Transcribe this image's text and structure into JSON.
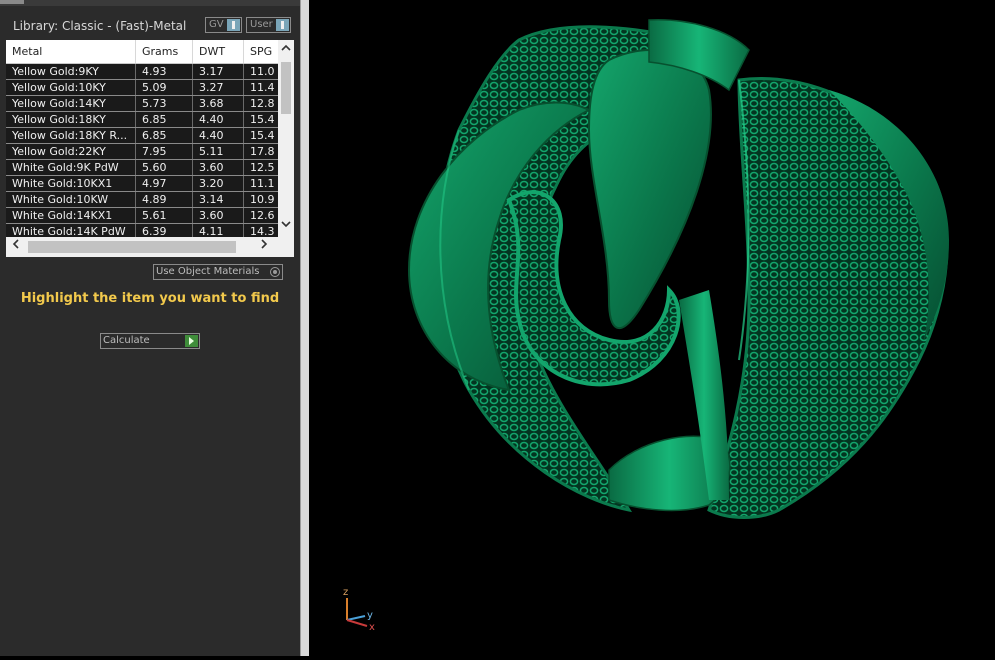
{
  "library": {
    "title": "Library: Classic - (Fast)-Metal",
    "toggles": [
      {
        "label": "GV"
      },
      {
        "label": "User"
      }
    ]
  },
  "table": {
    "columns": [
      "Metal",
      "Grams",
      "DWT",
      "SPG"
    ],
    "rows": [
      {
        "metal": "Yellow Gold:9KY",
        "grams": "4.93",
        "dwt": "3.17",
        "spg": "11.0"
      },
      {
        "metal": "Yellow Gold:10KY",
        "grams": "5.09",
        "dwt": "3.27",
        "spg": "11.4"
      },
      {
        "metal": "Yellow Gold:14KY",
        "grams": "5.73",
        "dwt": "3.68",
        "spg": "12.8"
      },
      {
        "metal": "Yellow Gold:18KY",
        "grams": "6.85",
        "dwt": "4.40",
        "spg": "15.4"
      },
      {
        "metal": "Yellow Gold:18KY R...",
        "grams": "6.85",
        "dwt": "4.40",
        "spg": "15.4"
      },
      {
        "metal": "Yellow Gold:22KY",
        "grams": "7.95",
        "dwt": "5.11",
        "spg": "17.8"
      },
      {
        "metal": "White Gold:9K PdW",
        "grams": "5.60",
        "dwt": "3.60",
        "spg": "12.5"
      },
      {
        "metal": "White Gold:10KX1",
        "grams": "4.97",
        "dwt": "3.20",
        "spg": "11.1"
      },
      {
        "metal": "White Gold:10KW",
        "grams": "4.89",
        "dwt": "3.14",
        "spg": "10.9"
      },
      {
        "metal": "White Gold:14KX1",
        "grams": "5.61",
        "dwt": "3.60",
        "spg": "12.6"
      },
      {
        "metal": "White Gold:14K PdW",
        "grams": "6.39",
        "dwt": "4.11",
        "spg": "14.3"
      }
    ]
  },
  "use_object_materials": {
    "label": "Use Object Materials"
  },
  "highlight_message": "Highlight the item you want to find",
  "calculate": {
    "label": "Calculate"
  },
  "axis": {
    "z": "z",
    "y": "y",
    "x": "x"
  },
  "colors": {
    "ring_green": "#0f8a5a",
    "ring_dark": "#04402a",
    "panel_bg": "#2b2b2b",
    "highlight": "#f2c94c"
  },
  "icons": {
    "scroll_up": "chevron-up-icon",
    "scroll_down": "chevron-down-icon",
    "scroll_left": "chevron-left-icon",
    "scroll_right": "chevron-right-icon"
  }
}
